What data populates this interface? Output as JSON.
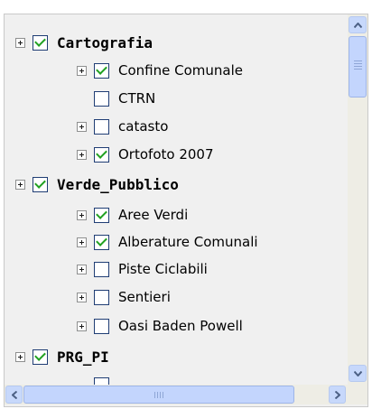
{
  "tree": {
    "items": [
      {
        "label": "Cartografia",
        "checked": true,
        "bold": true,
        "expander": true
      },
      {
        "label": "Confine Comunale",
        "checked": true,
        "bold": false,
        "expander": true
      },
      {
        "label": "CTRN",
        "checked": false,
        "bold": false,
        "expander": false
      },
      {
        "label": "catasto",
        "checked": false,
        "bold": false,
        "expander": true
      },
      {
        "label": "Ortofoto 2007",
        "checked": true,
        "bold": false,
        "expander": true
      },
      {
        "label": "Verde_Pubblico",
        "checked": true,
        "bold": true,
        "expander": true
      },
      {
        "label": "Aree Verdi",
        "checked": true,
        "bold": false,
        "expander": true
      },
      {
        "label": "Alberature Comunali",
        "checked": true,
        "bold": false,
        "expander": true
      },
      {
        "label": "Piste Ciclabili",
        "checked": false,
        "bold": false,
        "expander": true
      },
      {
        "label": "Sentieri",
        "checked": false,
        "bold": false,
        "expander": true
      },
      {
        "label": "Oasi Baden Powell",
        "checked": false,
        "bold": false,
        "expander": true
      },
      {
        "label": "PRG_PI",
        "checked": true,
        "bold": true,
        "expander": true
      }
    ]
  },
  "scrollbar": {
    "up_icon": "arrow-up-icon",
    "down_icon": "arrow-down-icon",
    "left_icon": "arrow-left-icon",
    "right_icon": "arrow-right-icon"
  },
  "colors": {
    "panel_bg": "#f0f0f0",
    "check_green": "#21a121",
    "checkbox_border": "#1f3d74",
    "scrollbar_thumb": "#c3d5fd"
  }
}
